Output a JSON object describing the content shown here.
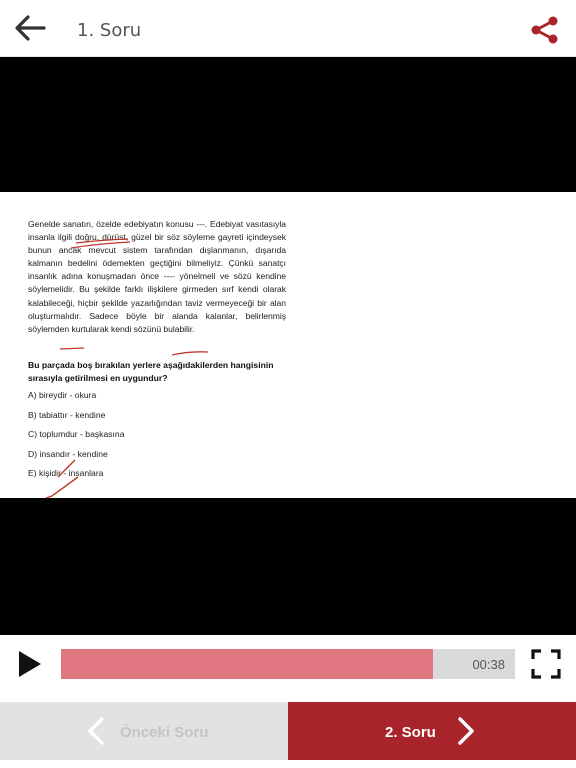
{
  "header": {
    "title": "1. Soru"
  },
  "question_image": {
    "passage": "Genelde sanatın, özelde edebiyatın konusu ---. Edebiyat vasıtasıyla insanla ilgili doğru, dürüst, güzel bir söz söyleme gayreti içindeysek bunun ancak mevcut sistem tarafından dışlanmanın, dışarıda kalmanın bedelini ödemekten geçtiğini bilmeliyiz. Çünkü sanatçı insanlık adına konuşmadan önce ---- yönelmeli ve sözü kendine söylemelidir. Bu şekilde farklı ilişkilere girmeden sırf kendi olarak kalabileceği, hiçbir şekilde yazarlığından taviz vermeyeceği bir alan oluşturmalıdır. Sadece böyle bir alanda kalanlar, belirlenmiş söylemden kurtularak kendi sözünü bulabilir.",
    "question": "Bu parçada boş bırakılan yerlere aşağıdakilerden hangisinin sırasıyla getirilmesi en uygundur?",
    "options": [
      "A) bireydir - okura",
      "B) tabiattır - kendine",
      "C) toplumdur - başkasına",
      "D) insandır - kendine",
      "E) kişidir - insanlara"
    ]
  },
  "player": {
    "progress": 0.82,
    "time": "00:38"
  },
  "navigation": {
    "prev_label": "Önceki Soru",
    "next_label": "2. Soru"
  },
  "colors": {
    "accent": "#a8242a",
    "progress_fill": "#e07680",
    "progress_track": "#d9d9d9"
  },
  "icons": {
    "back": "arrow-left-icon",
    "share": "share-icon",
    "play": "play-icon",
    "fullscreen": "fullscreen-icon",
    "prev": "chevron-left-icon",
    "next": "chevron-right-icon"
  }
}
